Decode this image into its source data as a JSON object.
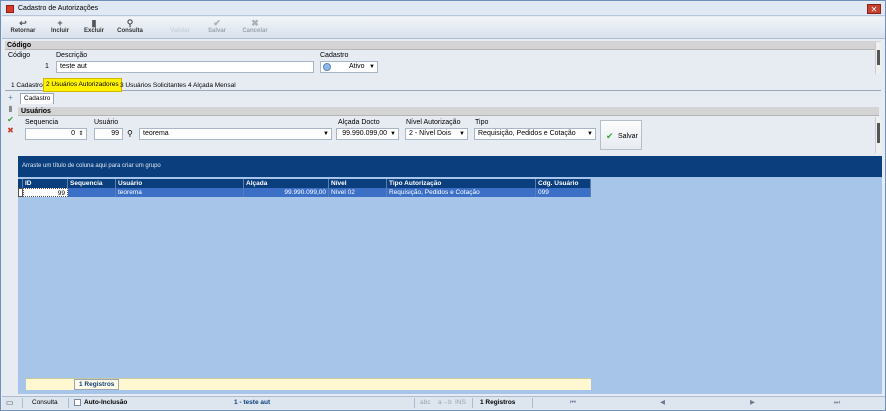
{
  "window": {
    "title": "Cadastro de Autorizações",
    "close_glyph": "✕"
  },
  "toolbar": [
    {
      "label": "Retornar",
      "icon": "↩",
      "icon_name": "return-icon",
      "enabled": true
    },
    {
      "label": "Incluir",
      "icon": "+",
      "icon_name": "plus-icon",
      "enabled": true
    },
    {
      "label": "Excluir",
      "icon": "▮",
      "icon_name": "trash-icon",
      "enabled": true
    },
    {
      "label": "Consulta",
      "icon": "⚲",
      "icon_name": "search-icon",
      "enabled": true
    },
    {
      "label": "Validar",
      "icon": "",
      "icon_name": "validate-icon",
      "enabled": false
    },
    {
      "label": "Salvar",
      "icon": "✔",
      "icon_name": "check-icon",
      "enabled": false
    },
    {
      "label": "Cancelar",
      "icon": "✖",
      "icon_name": "cancel-icon",
      "enabled": false
    }
  ],
  "codigo_section": {
    "header": "Código",
    "codigo_label": "Código",
    "codigo_value": "1",
    "descricao_label": "Descrição",
    "descricao_value": "teste aut",
    "cadastro_label": "Cadastro",
    "cadastro_value": "Ativo"
  },
  "tabs": [
    {
      "label": "1 Cadastro",
      "active": false
    },
    {
      "label": "2 Usuários Autorizadores",
      "active": true
    },
    {
      "label": "3 Usuários Solicitantes",
      "active": false
    },
    {
      "label": "4 Alçada Mensal",
      "active": false
    }
  ],
  "subtab": "Cadastro",
  "usuarios": {
    "header": "Usuários",
    "sequencia_label": "Sequencia",
    "sequencia_value": "0",
    "usuario_label": "Usuário",
    "usuario_code": "99",
    "usuario_name": "teorema",
    "alcada_label": "Alçada Docto",
    "alcada_value": "99.990.099,00",
    "nivel_label": "Nível Autorização",
    "nivel_value": "2 - Nível Dois",
    "tipo_label": "Tipo",
    "tipo_value": "Requisição, Pedidos e Cotação",
    "save_label": "Salvar"
  },
  "grid": {
    "group_hint": "Arraste um título de coluna aqui para criar um grupo",
    "columns": [
      "ID",
      "Sequencia",
      "Usuário",
      "Alçada",
      "Nível",
      "Tipo Autorização",
      "Cdg. Usuário"
    ],
    "rows": [
      [
        "99",
        "",
        "teorema",
        "99.990.099,00",
        "Nível 02",
        "Requisição, Pedidos e Cotação",
        "099"
      ]
    ],
    "footer_count": "1 Registros"
  },
  "statusbar": {
    "mode": "Consulta",
    "auto_inclusao": "Auto-Inclusão",
    "current_record": "1 - teste aut",
    "indicators": [
      "abc",
      "a→b",
      "INS"
    ],
    "records": "1 Registros",
    "nav": [
      "⏮",
      "◀",
      "▶",
      "⏭"
    ]
  },
  "colors": {
    "grid_header": "#0b3e7c",
    "grid_selected": "#3c70c6",
    "grid_bg": "#a6c5e8",
    "active_tab": "#fff200"
  }
}
